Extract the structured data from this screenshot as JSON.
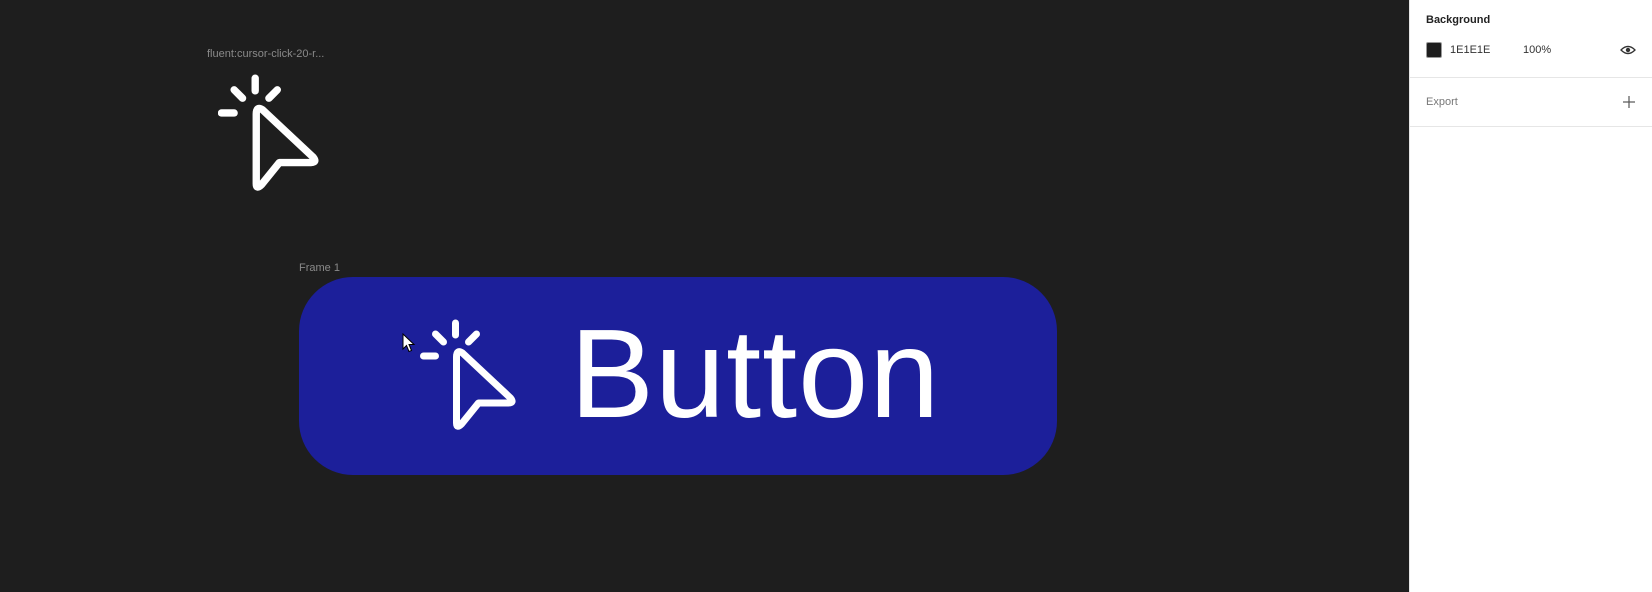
{
  "canvas": {
    "background_color": "#1e1e1e",
    "icon_layer": {
      "label": "fluent:cursor-click-20-r...",
      "icon": "cursor-click-icon"
    },
    "frame": {
      "label": "Frame 1",
      "button_text": "Button",
      "button_color": "#1c1f9a",
      "text_color": "#ffffff",
      "icon": "cursor-click-icon"
    }
  },
  "panel": {
    "background": {
      "title": "Background",
      "hex": "1E1E1E",
      "opacity": "100%",
      "swatch_color": "#1e1e1e",
      "visibility_icon": "eye-icon"
    },
    "export": {
      "title": "Export",
      "add_icon": "plus-icon"
    }
  }
}
